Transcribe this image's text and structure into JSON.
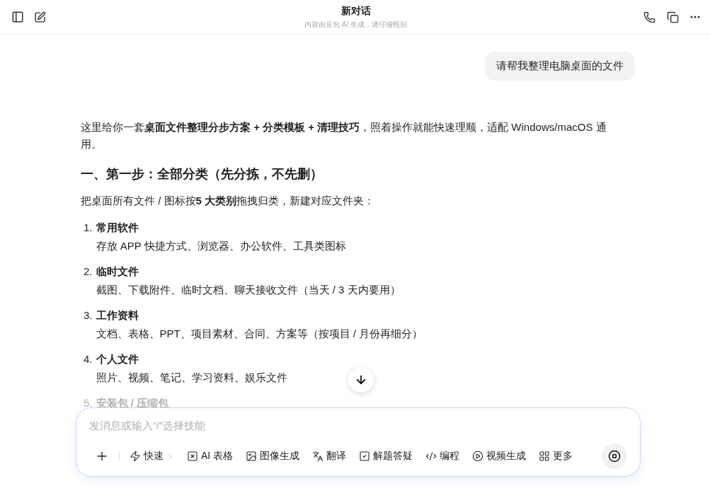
{
  "header": {
    "title": "新对话",
    "subtitle": "内容由豆包 AI 生成，请仔细甄别"
  },
  "user_message": "请帮我整理电脑桌面的文件",
  "reply": {
    "intro": "这里给你一套**桌面文件整理分步方案 + 分类模板 + 清理技巧**，照着操作就能快速理顺，适配 Windows/macOS 通用。",
    "heading": "一、第一步：全部分类（先分拣，不先删）",
    "lead": "把桌面所有文件 / 图标按**5 大类别**拖拽归类，新建对应文件夹：",
    "items": [
      {
        "number": "1.",
        "title": "常用软件",
        "detail": "存放 APP 快捷方式、浏览器、办公软件、工具类图标",
        "faded": false
      },
      {
        "number": "2.",
        "title": "临时文件",
        "detail": "截图、下载附件、临时文档、聊天接收文件（当天 / 3 天内要用）",
        "faded": false
      },
      {
        "number": "3.",
        "title": "工作资料",
        "detail": "文档、表格、PPT、项目素材、合同、方案等（按项目 / 月份再细分）",
        "faded": false
      },
      {
        "number": "4.",
        "title": "个人文件",
        "detail": "照片、视频、笔记、学习资料、娱乐文件",
        "faded": false
      },
      {
        "number": "5.",
        "title": "安装包 / 压缩包",
        "faded": true
      }
    ]
  },
  "composer": {
    "placeholder": "发消息或输入“/”选择技能",
    "tools": [
      {
        "kind": "fast",
        "label": "快速"
      },
      {
        "kind": "table",
        "label": "AI 表格"
      },
      {
        "kind": "image",
        "label": "图像生成"
      },
      {
        "kind": "translate",
        "label": "翻译"
      },
      {
        "kind": "solve",
        "label": "解题答疑"
      },
      {
        "kind": "code",
        "label": "编程"
      },
      {
        "kind": "video",
        "label": "视频生成"
      },
      {
        "kind": "more",
        "label": "更多"
      }
    ]
  }
}
